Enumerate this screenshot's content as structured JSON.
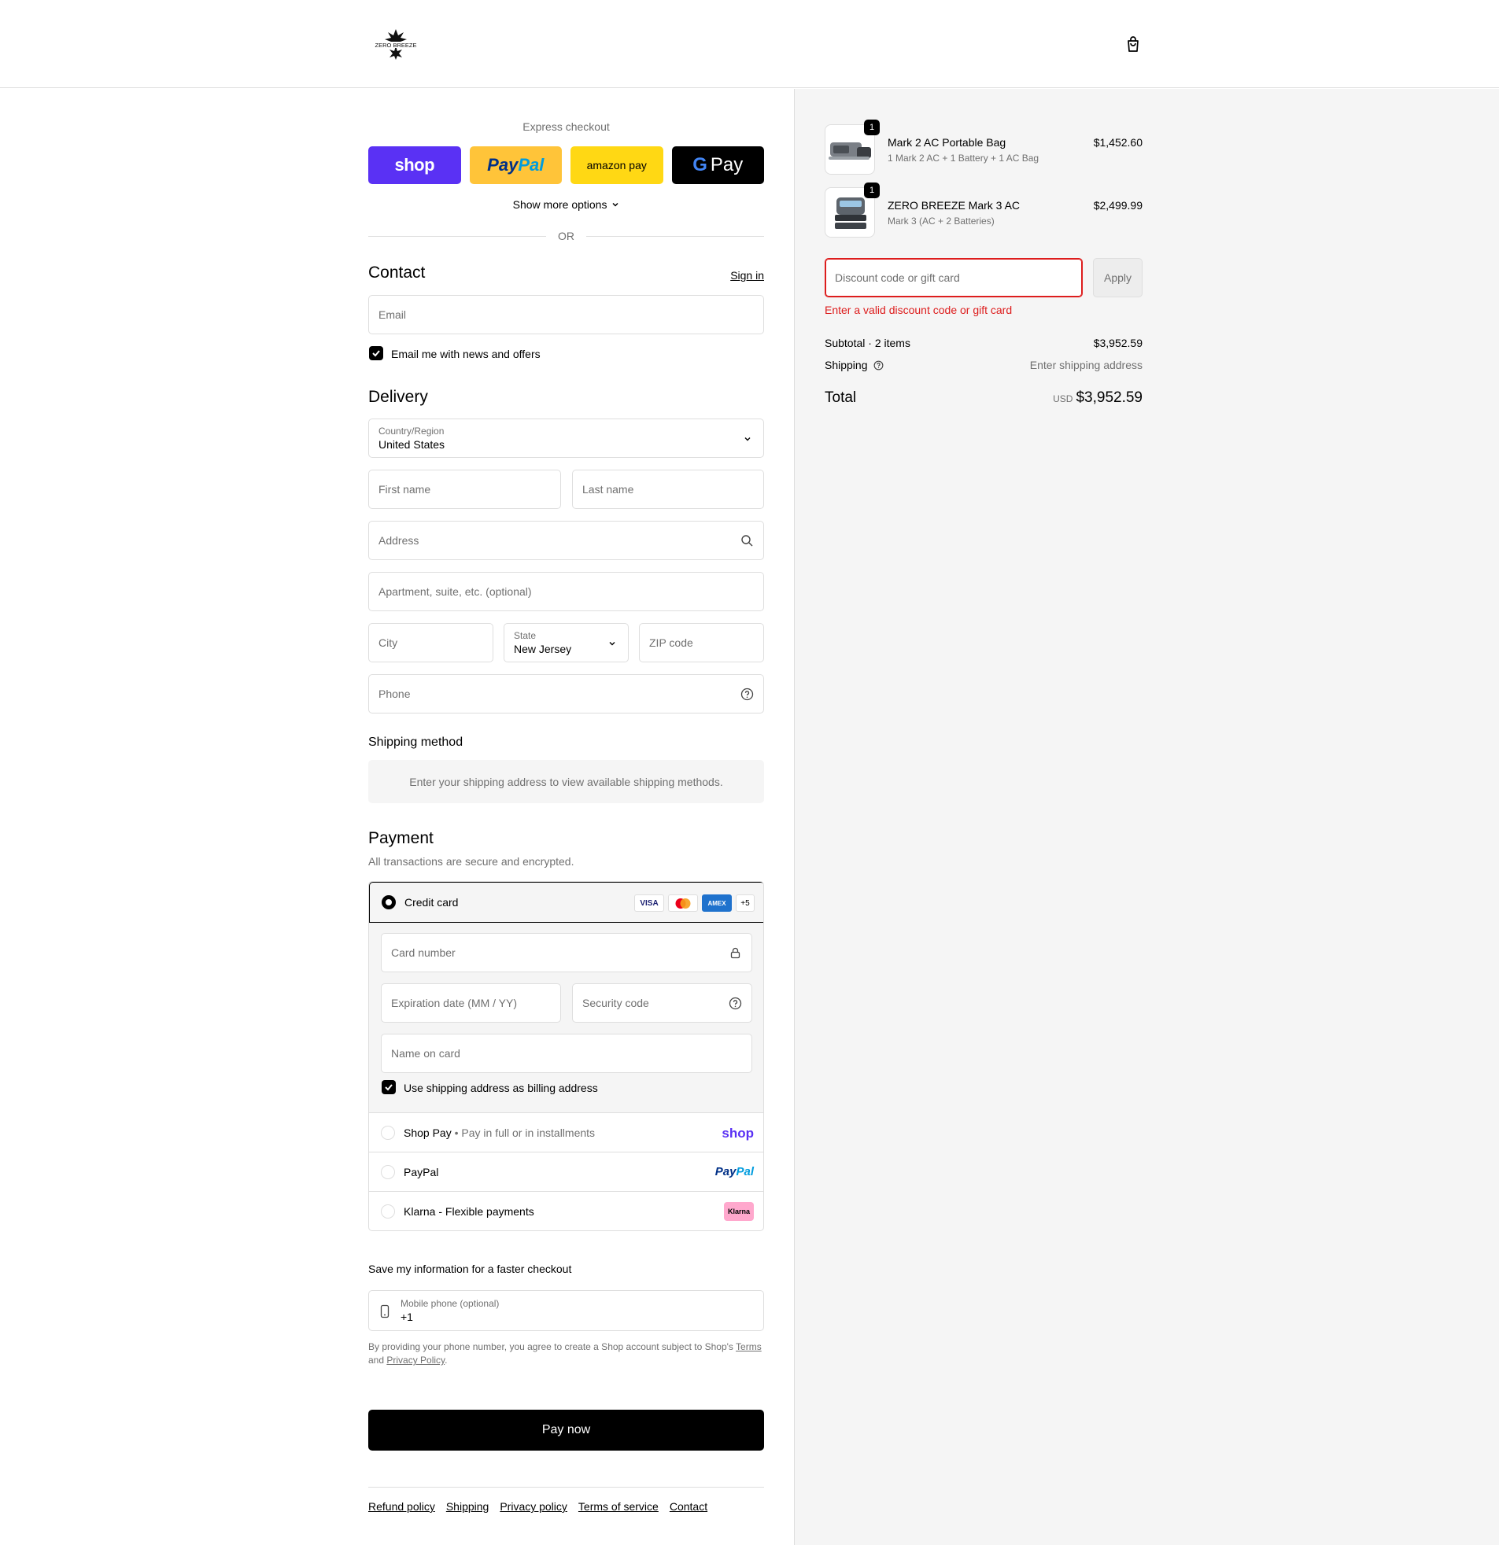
{
  "brand": {
    "logo_alt": "ZERO BREEZE"
  },
  "express": {
    "title": "Express checkout",
    "buttons": {
      "shop": "shop",
      "paypal_a": "Pay",
      "paypal_b": "Pal",
      "amazon": "amazon pay",
      "gpay": "Pay"
    },
    "more_options": "Show more options",
    "or": "OR"
  },
  "contact": {
    "heading": "Contact",
    "sign_in": "Sign in",
    "email_placeholder": "Email",
    "news_label": "Email me with news and offers",
    "news_checked": true
  },
  "delivery": {
    "heading": "Delivery",
    "country_label": "Country/Region",
    "country_value": "United States",
    "first_name": "First name",
    "last_name": "Last name",
    "address": "Address",
    "apartment": "Apartment, suite, etc. (optional)",
    "city": "City",
    "state_label": "State",
    "state_value": "New Jersey",
    "zip": "ZIP code",
    "phone": "Phone"
  },
  "shipping_method": {
    "heading": "Shipping method",
    "message": "Enter your shipping address to view available shipping methods."
  },
  "payment": {
    "heading": "Payment",
    "subheading": "All transactions are secure and encrypted.",
    "credit_card": {
      "label": "Credit card",
      "logos": [
        "VISA",
        "",
        "AMEX",
        "+5"
      ],
      "card_number": "Card number",
      "expiry": "Expiration date (MM / YY)",
      "security": "Security code",
      "name_on_card": "Name on card",
      "billing_same": "Use shipping address as billing address"
    },
    "shop_pay": {
      "label": "Shop Pay",
      "sub": "Pay in full or in installments",
      "logo": "shop"
    },
    "paypal": {
      "label": "PayPal",
      "logo_a": "Pay",
      "logo_b": "Pal"
    },
    "klarna": {
      "label": "Klarna - Flexible payments",
      "logo": "Klarna"
    }
  },
  "save_info": {
    "heading": "Save my information for a faster checkout",
    "phone_label": "Mobile phone (optional)",
    "phone_value": "+1",
    "terms_prefix": "By providing your phone number, you agree to create a Shop account subject to Shop's ",
    "terms_link": "Terms",
    "terms_and": " and ",
    "privacy_link": "Privacy Policy",
    "terms_suffix": "."
  },
  "pay_now": "Pay now",
  "footer": [
    "Refund policy",
    "Shipping",
    "Privacy policy",
    "Terms of service",
    "Contact"
  ],
  "order": {
    "items": [
      {
        "qty": "1",
        "title": "Mark 2 AC Portable Bag",
        "variant": "1 Mark 2 AC + 1 Battery + 1 AC Bag",
        "price": "$1,452.60"
      },
      {
        "qty": "1",
        "title": "ZERO BREEZE Mark 3 AC",
        "variant": "Mark 3 (AC + 2 Batteries)",
        "price": "$2,499.99"
      }
    ],
    "discount_placeholder": "Discount code or gift card",
    "apply": "Apply",
    "discount_error": "Enter a valid discount code or gift card",
    "subtotal_label": "Subtotal · 2 items",
    "subtotal_value": "$3,952.59",
    "shipping_label": "Shipping",
    "shipping_value": "Enter shipping address",
    "total_label": "Total",
    "currency": "USD",
    "total_value": "$3,952.59"
  },
  "colors": {
    "accent_error": "#dd1d1d",
    "shop_purple": "#5a31f4",
    "paypal_yellow": "#ffc439",
    "amazon_yellow": "#ffd814"
  }
}
